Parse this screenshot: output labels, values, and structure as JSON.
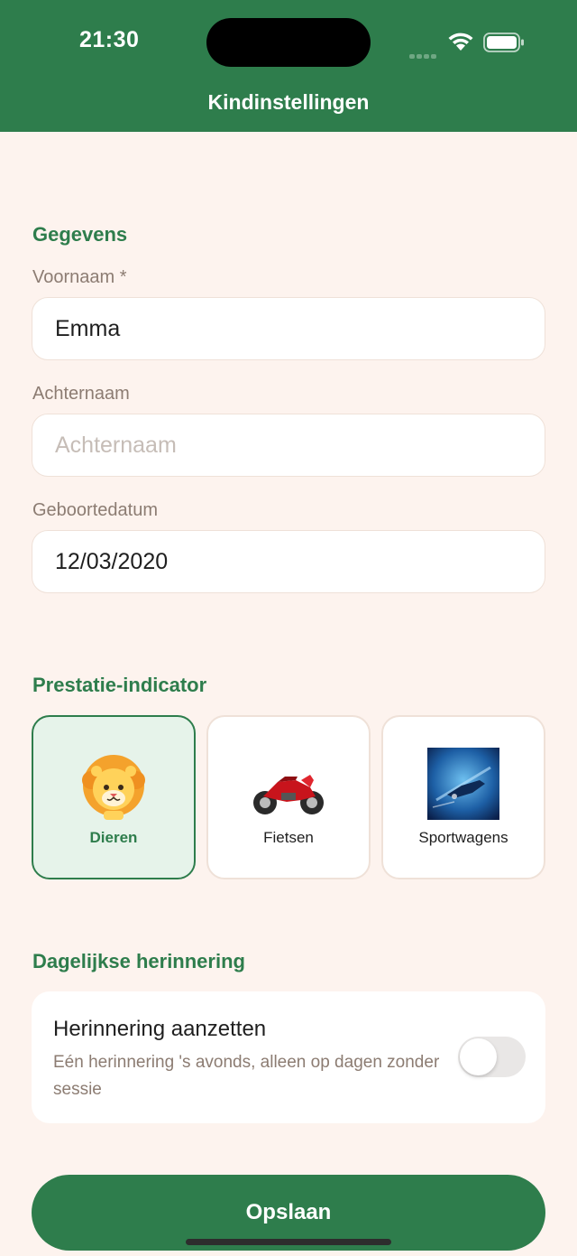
{
  "status_bar": {
    "time": "21:30"
  },
  "header": {
    "title": "Kindinstellingen"
  },
  "details": {
    "section_title": "Gegevens",
    "first_name": {
      "label": "Voornaam *",
      "value": "Emma"
    },
    "last_name": {
      "label": "Achternaam",
      "value": "",
      "placeholder": "Achternaam"
    },
    "birth_date": {
      "label": "Geboortedatum",
      "value": "12/03/2020"
    }
  },
  "indicator": {
    "section_title": "Prestatie-indicator",
    "options": [
      {
        "label": "Dieren",
        "icon": "lion-icon",
        "selected": true
      },
      {
        "label": "Fietsen",
        "icon": "motorbike-icon",
        "selected": false
      },
      {
        "label": "Sportwagens",
        "icon": "sportscar-icon",
        "selected": false
      }
    ]
  },
  "reminder": {
    "section_title": "Dagelijkse herinnering",
    "title": "Herinnering aanzetten",
    "description": "Eén herinnering 's avonds, alleen op dagen zonder sessie",
    "enabled": false
  },
  "save_button": {
    "label": "Opslaan"
  },
  "colors": {
    "primary": "#2e7d4c",
    "background": "#fdf3ee",
    "muted_text": "#8c7c72",
    "card_border": "#efe1d8"
  }
}
